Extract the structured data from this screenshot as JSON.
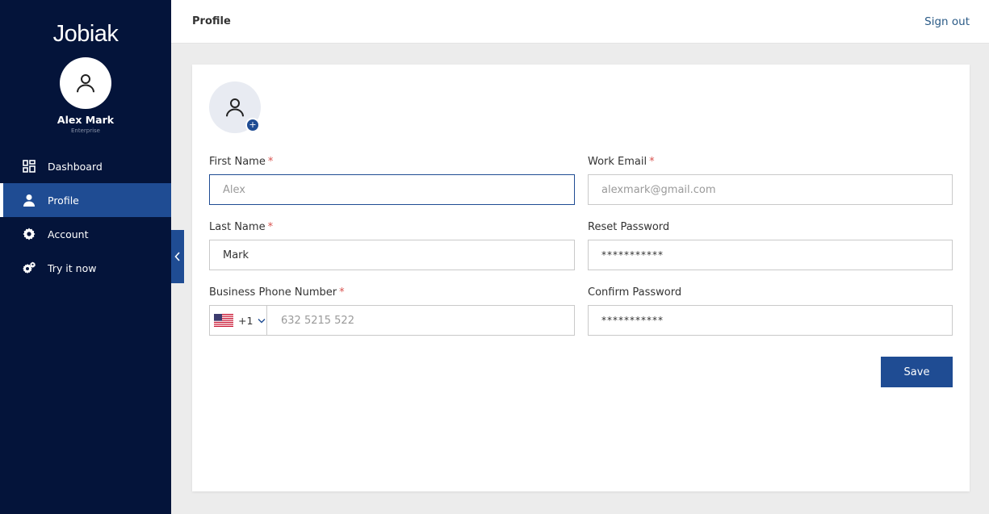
{
  "brand": {
    "logo": "Jobiak"
  },
  "user": {
    "name": "Alex Mark",
    "role": "Enterprise"
  },
  "nav": {
    "items": [
      {
        "label": "Dashboard"
      },
      {
        "label": "Profile"
      },
      {
        "label": "Account"
      },
      {
        "label": "Try it now"
      }
    ],
    "active": "Profile"
  },
  "header": {
    "title": "Profile",
    "signout": "Sign out"
  },
  "form": {
    "first_name": {
      "label": "First Name",
      "required": "*",
      "placeholder": "Alex"
    },
    "last_name": {
      "label": "Last Name",
      "required": "*",
      "value": "Mark"
    },
    "phone": {
      "label": "Business Phone Number",
      "required": "*",
      "country_code": "+1",
      "placeholder": "632 5215 522"
    },
    "work_email": {
      "label": "Work Email",
      "required": "*",
      "placeholder": "alexmark@gmail.com"
    },
    "reset_password": {
      "label": "Reset Password",
      "value": "***********"
    },
    "confirm_password": {
      "label": "Confirm Password",
      "value": "***********"
    },
    "avatar_add": "+",
    "save_label": "Save"
  },
  "colors": {
    "sidebar": "#04143a",
    "accent": "#1f4c93",
    "required": "#d9534f"
  }
}
